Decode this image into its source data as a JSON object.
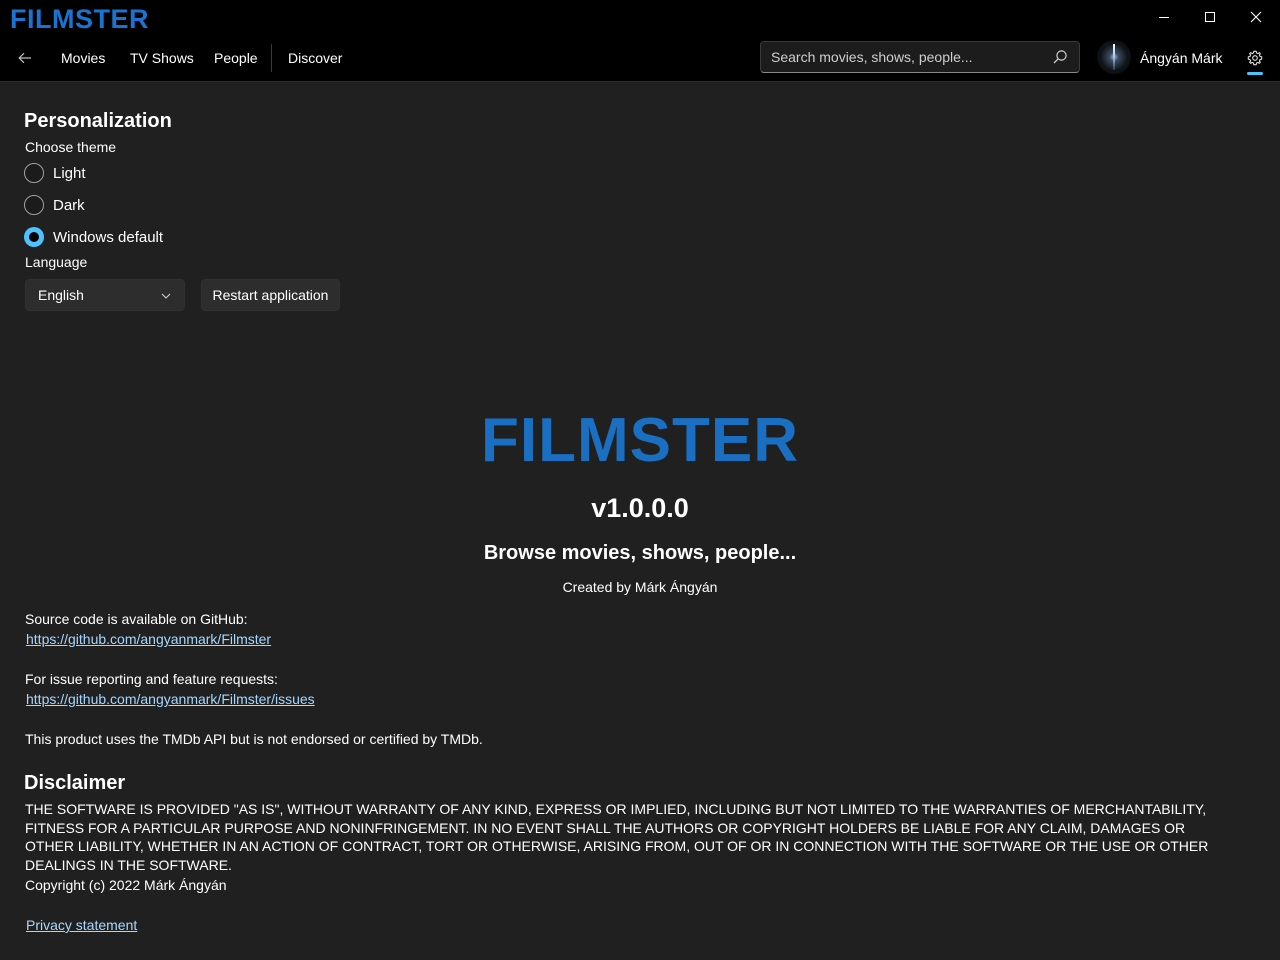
{
  "app": {
    "logo_text": "FILMSTER",
    "brand_color": "#1a73d1",
    "accent_color": "#4cc2ff"
  },
  "window_controls": {
    "minimize_icon": "minimize-icon",
    "maximize_icon": "maximize-icon",
    "close_icon": "close-icon"
  },
  "nav": {
    "back_icon": "back-arrow-icon",
    "items": [
      {
        "label": "Movies"
      },
      {
        "label": "TV Shows"
      },
      {
        "label": "People"
      },
      {
        "label": "Discover"
      }
    ]
  },
  "search": {
    "value": "",
    "placeholder": "Search movies, shows, people...",
    "icon": "search-icon"
  },
  "user": {
    "name": "Ángyán Márk"
  },
  "settings": {
    "icon": "gear-icon",
    "selected": true
  },
  "personalization": {
    "title": "Personalization",
    "theme_label": "Choose theme",
    "themes": [
      {
        "label": "Light",
        "checked": false
      },
      {
        "label": "Dark",
        "checked": false
      },
      {
        "label": "Windows default",
        "checked": true
      }
    ],
    "language_label": "Language",
    "language_value": "English",
    "restart_label": "Restart application"
  },
  "about": {
    "logo_text": "FILMSTER",
    "version": "v1.0.0.0",
    "tagline": "Browse movies, shows, people...",
    "created_by": "Created by Márk Ángyán",
    "source_text": "Source code is available on GitHub:",
    "source_link": "https://github.com/angyanmark/Filmster",
    "issue_text": "For issue reporting and feature requests:",
    "issue_link": "https://github.com/angyanmark/Filmster/issues",
    "tmdb_text": "This product uses the TMDb API but is not endorsed or certified by TMDb."
  },
  "disclaimer": {
    "title": "Disclaimer",
    "text": "THE SOFTWARE IS PROVIDED \"AS IS\", WITHOUT WARRANTY OF ANY KIND, EXPRESS OR IMPLIED, INCLUDING BUT NOT LIMITED TO THE WARRANTIES OF MERCHANTABILITY, FITNESS FOR A PARTICULAR PURPOSE AND NONINFRINGEMENT. IN NO EVENT SHALL THE AUTHORS OR COPYRIGHT HOLDERS BE LIABLE FOR ANY CLAIM, DAMAGES OR OTHER LIABILITY, WHETHER IN AN ACTION OF CONTRACT, TORT OR OTHERWISE, ARISING FROM, OUT OF OR IN CONNECTION WITH THE SOFTWARE OR THE USE OR OTHER DEALINGS IN THE SOFTWARE.",
    "copyright": "Copyright (c) 2022 Márk Ángyán",
    "privacy_link": "Privacy statement"
  }
}
